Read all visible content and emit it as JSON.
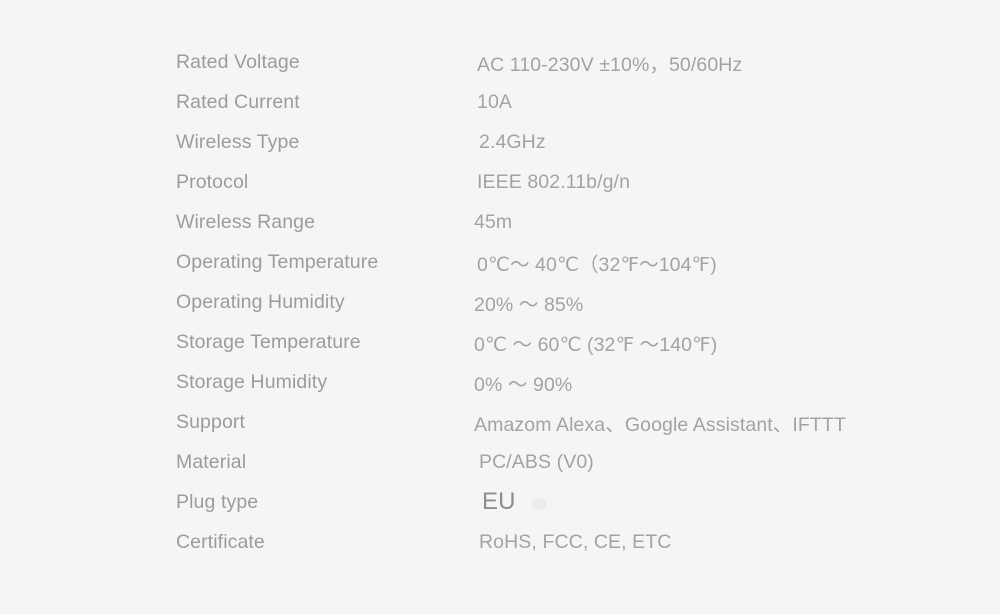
{
  "document": {
    "type": "product-specification-table",
    "background_color": "#f5f5f5",
    "label_color": "#9c9c9c",
    "value_color": "#a3a3a3"
  },
  "specs": [
    {
      "label": "Rated Voltage",
      "value": "AC 110-230V ±10%，50/60Hz",
      "indent": 1,
      "emphasis": false
    },
    {
      "label": "Rated Current",
      "value": "10A",
      "indent": 1,
      "emphasis": false
    },
    {
      "label": "Wireless Type",
      "value": "2.4GHz",
      "indent": 2,
      "emphasis": false
    },
    {
      "label": "Protocol",
      "value": "IEEE 802.11b/g/n",
      "indent": 1,
      "emphasis": false
    },
    {
      "label": "Wireless Range",
      "value": "45m",
      "indent": 0,
      "emphasis": false
    },
    {
      "label": "Operating Temperature",
      "value": "0℃〜 40℃（32℉〜104℉)",
      "indent": 1,
      "emphasis": false
    },
    {
      "label": "Operating Humidity",
      "value": "20% 〜 85%",
      "indent": 0,
      "emphasis": false
    },
    {
      "label": "Storage Temperature",
      "value": "0℃ 〜 60℃ (32℉ 〜140℉)",
      "indent": 0,
      "emphasis": false
    },
    {
      "label": "Storage Humidity",
      "value": "0% 〜 90%",
      "indent": 0,
      "emphasis": false
    },
    {
      "label": "Support",
      "value": "Amazom Alexa、Google Assistant、IFTTT",
      "indent": 0,
      "emphasis": false
    },
    {
      "label": "Material",
      "value": "PC/ABS (V0)",
      "indent": 2,
      "emphasis": false
    },
    {
      "label": "Plug type",
      "value": "EU",
      "indent": 3,
      "emphasis": true
    },
    {
      "label": "Certificate",
      "value": "RoHS, FCC, CE, ETC",
      "indent": 2,
      "emphasis": false
    }
  ]
}
